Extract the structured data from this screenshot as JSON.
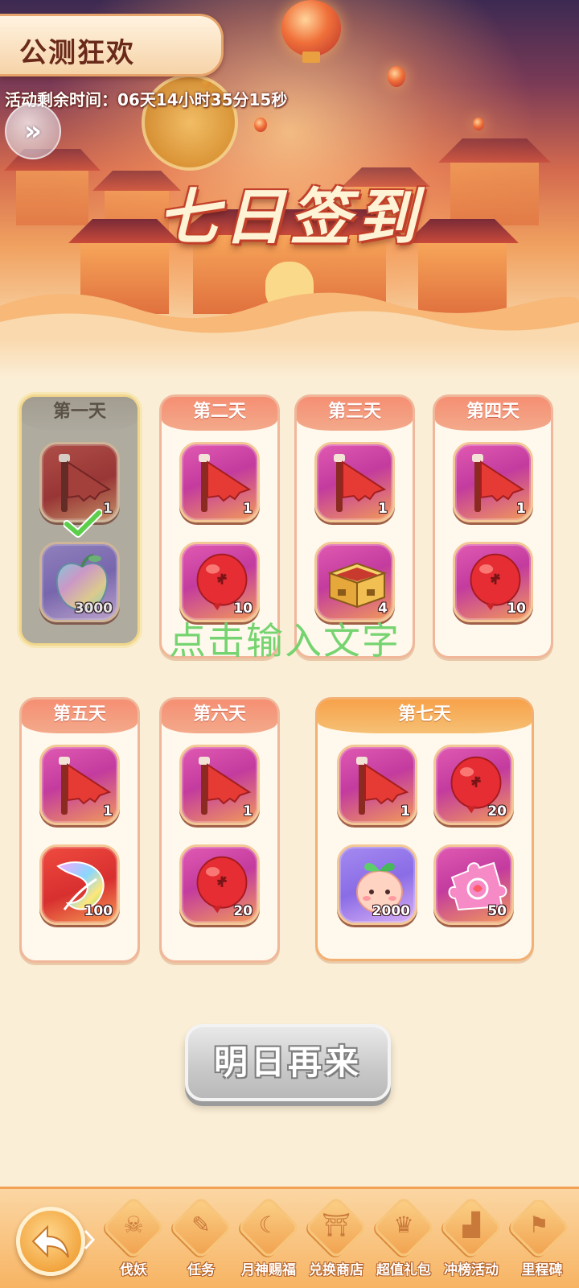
{
  "header": {
    "event_title": "公测狂欢",
    "countdown": "活动剩余时间：06天14小时35分15秒",
    "collapse_icon": "double-chevron-right-icon",
    "main_title": "七日签到"
  },
  "days": [
    {
      "label": "第一天",
      "claimed": true,
      "rewards": [
        {
          "icon": "red-flag-icon",
          "qty": "1"
        },
        {
          "icon": "rainbow-apple-icon",
          "qty": "3000"
        }
      ]
    },
    {
      "label": "第二天",
      "claimed": false,
      "rewards": [
        {
          "icon": "red-flag-icon",
          "qty": "1"
        },
        {
          "icon": "red-balloon-icon",
          "qty": "10"
        }
      ]
    },
    {
      "label": "第三天",
      "claimed": false,
      "rewards": [
        {
          "icon": "red-flag-icon",
          "qty": "1"
        },
        {
          "icon": "gold-chest-icon",
          "qty": "4"
        }
      ]
    },
    {
      "label": "第四天",
      "claimed": false,
      "rewards": [
        {
          "icon": "red-flag-icon",
          "qty": "1"
        },
        {
          "icon": "red-balloon-icon",
          "qty": "10"
        }
      ]
    },
    {
      "label": "第五天",
      "claimed": false,
      "rewards": [
        {
          "icon": "red-flag-icon",
          "qty": "1"
        },
        {
          "icon": "rainbow-feather-icon",
          "qty": "100"
        }
      ]
    },
    {
      "label": "第六天",
      "claimed": false,
      "rewards": [
        {
          "icon": "red-flag-icon",
          "qty": "1"
        },
        {
          "icon": "red-balloon-icon",
          "qty": "20"
        }
      ]
    },
    {
      "label": "第七天",
      "claimed": false,
      "rewards": [
        {
          "icon": "red-flag-icon",
          "qty": "1"
        },
        {
          "icon": "red-balloon-icon",
          "qty": "20"
        },
        {
          "icon": "peach-sprite-icon",
          "qty": "2000"
        },
        {
          "icon": "puzzle-piece-icon",
          "qty": "50"
        }
      ]
    }
  ],
  "overlay_text": "点击输入文字",
  "action_button": "明日再来",
  "bottom_nav": {
    "back_icon": "back-arrow-icon",
    "items": [
      {
        "label": "伐妖",
        "icon": "demon-icon"
      },
      {
        "label": "任务",
        "icon": "scroll-icon"
      },
      {
        "label": "月神赐福",
        "icon": "moon-icon"
      },
      {
        "label": "兑换商店",
        "icon": "shop-icon"
      },
      {
        "label": "超值礼包",
        "icon": "gift-bag-icon"
      },
      {
        "label": "冲榜活动",
        "icon": "podium-icon"
      },
      {
        "label": "里程碑",
        "icon": "milestone-icon"
      }
    ]
  },
  "colors": {
    "accent_orange": "#f7a24a",
    "day_header": "#f58f73",
    "check_green": "#5ccf4a",
    "watermark_green": "#6ed36a"
  }
}
